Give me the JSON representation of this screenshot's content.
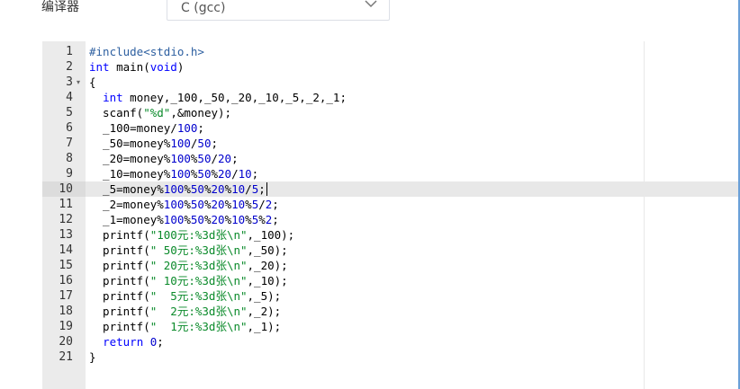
{
  "toolbar": {
    "compiler_label": "编译器",
    "compiler_value": "C (gcc)"
  },
  "editor": {
    "active_line": 10,
    "lines": [
      {
        "n": "1",
        "text": "#include<stdio.h>"
      },
      {
        "n": "2",
        "text": "int main(void)"
      },
      {
        "n": "3",
        "text": "{"
      },
      {
        "n": "4",
        "text": "  int money,_100,_50,_20,_10,_5,_2,_1;"
      },
      {
        "n": "5",
        "text": "  scanf(\"%d\",&money);"
      },
      {
        "n": "6",
        "text": "  _100=money/100;"
      },
      {
        "n": "7",
        "text": "  _50=money%100/50;"
      },
      {
        "n": "8",
        "text": "  _20=money%100%50/20;"
      },
      {
        "n": "9",
        "text": "  _10=money%100%50%20/10;"
      },
      {
        "n": "10",
        "text": "  _5=money%100%50%20%10/5;"
      },
      {
        "n": "11",
        "text": "  _2=money%100%50%20%10%5/2;"
      },
      {
        "n": "12",
        "text": "  _1=money%100%50%20%10%5%2;"
      },
      {
        "n": "13",
        "text": "  printf(\"100元:%3d张\\n\",_100);"
      },
      {
        "n": "14",
        "text": "  printf(\" 50元:%3d张\\n\",_50);"
      },
      {
        "n": "15",
        "text": "  printf(\" 20元:%3d张\\n\",_20);"
      },
      {
        "n": "16",
        "text": "  printf(\" 10元:%3d张\\n\",_10);"
      },
      {
        "n": "17",
        "text": "  printf(\"  5元:%3d张\\n\",_5);"
      },
      {
        "n": "18",
        "text": "  printf(\"  2元:%3d张\\n\",_2);"
      },
      {
        "n": "19",
        "text": "  printf(\"  1元:%3d张\\n\",_1);"
      },
      {
        "n": "20",
        "text": "  return 0;"
      },
      {
        "n": "21",
        "text": "}"
      }
    ]
  },
  "colors": {
    "keyword": "#0000ff",
    "number": "#0000cd",
    "string": "#0a8a2a",
    "gutter": "#ebebeb"
  }
}
